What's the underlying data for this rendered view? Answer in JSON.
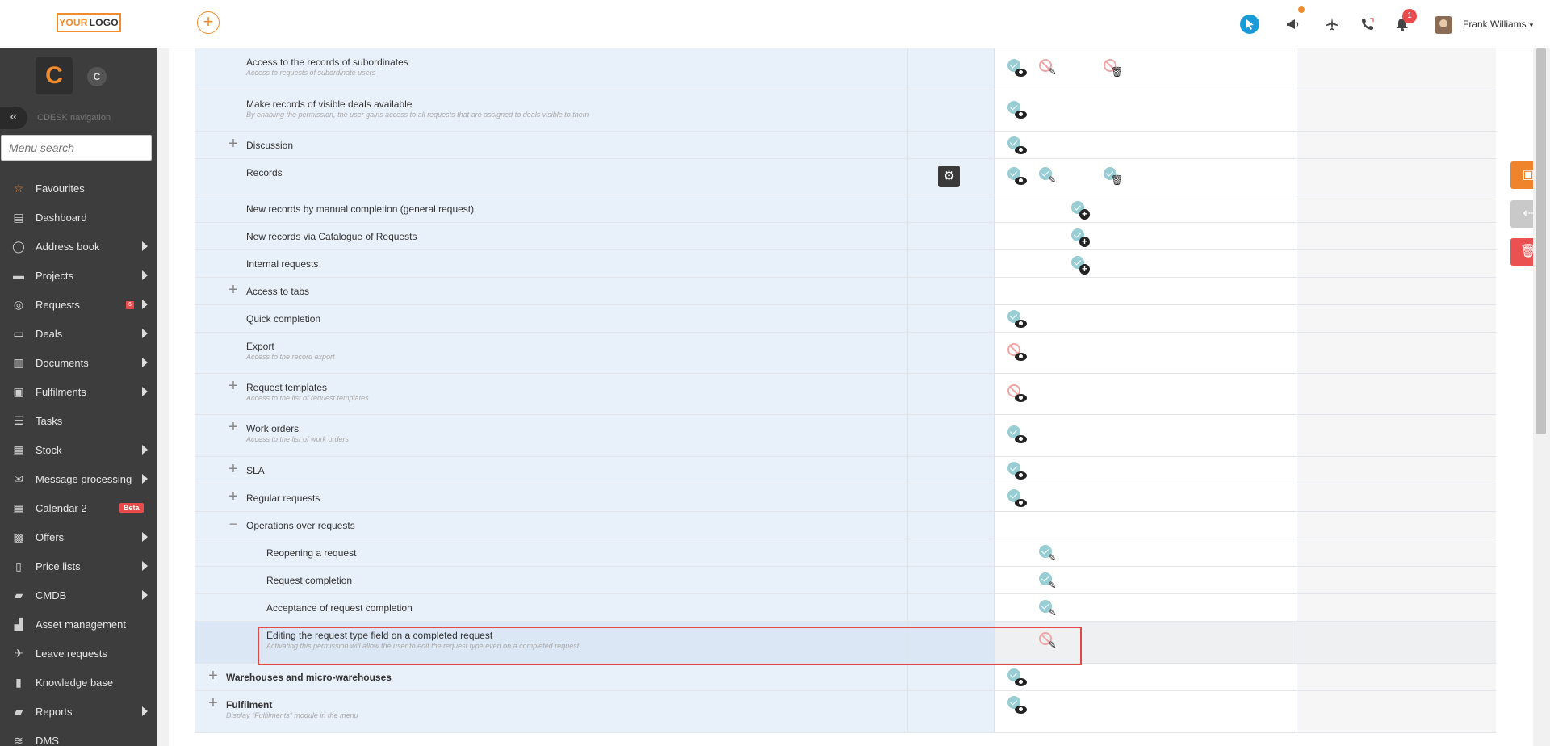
{
  "header": {
    "logo_part1": "YOUR",
    "logo_part2": "LOGO",
    "add_symbol": "+",
    "notifications_count": "1",
    "user_name": "Frank Williams",
    "caret": "▾"
  },
  "sidebar": {
    "logo_letter": "C",
    "secondary_letter": "C",
    "collapse_symbol": "«",
    "nav_label": "CDESK navigation",
    "search_placeholder": "Menu search",
    "items": [
      {
        "label": "Favourites",
        "icon": "star-icon",
        "glyph": "☆",
        "arrow": false
      },
      {
        "label": "Dashboard",
        "icon": "dashboard-icon",
        "glyph": "▤",
        "arrow": false
      },
      {
        "label": "Address book",
        "icon": "person-icon",
        "glyph": "◯",
        "arrow": true
      },
      {
        "label": "Projects",
        "icon": "projects-icon",
        "glyph": "▬",
        "arrow": true
      },
      {
        "label": "Requests",
        "icon": "requests-icon",
        "glyph": "◎",
        "arrow": true,
        "badge": "6"
      },
      {
        "label": "Deals",
        "icon": "deals-icon",
        "glyph": "▭",
        "arrow": true
      },
      {
        "label": "Documents",
        "icon": "documents-icon",
        "glyph": "▥",
        "arrow": true
      },
      {
        "label": "Fulfilments",
        "icon": "box-icon",
        "glyph": "▣",
        "arrow": true
      },
      {
        "label": "Tasks",
        "icon": "tasks-icon",
        "glyph": "☰",
        "arrow": false
      },
      {
        "label": "Stock",
        "icon": "stock-icon",
        "glyph": "▦",
        "arrow": true
      },
      {
        "label": "Message processing",
        "icon": "envelope-icon",
        "glyph": "✉",
        "arrow": true
      },
      {
        "label": "Calendar 2",
        "icon": "calendar-icon",
        "glyph": "▦",
        "arrow": false,
        "beta": "Beta"
      },
      {
        "label": "Offers",
        "icon": "gift-icon",
        "glyph": "▩",
        "arrow": true
      },
      {
        "label": "Price lists",
        "icon": "pricelist-icon",
        "glyph": "▯",
        "arrow": true
      },
      {
        "label": "CMDB",
        "icon": "folder-icon",
        "glyph": "▰",
        "arrow": true
      },
      {
        "label": "Asset management",
        "icon": "asset-icon",
        "glyph": "▟",
        "arrow": false
      },
      {
        "label": "Leave requests",
        "icon": "plane-icon",
        "glyph": "✈",
        "arrow": false
      },
      {
        "label": "Knowledge base",
        "icon": "book-icon",
        "glyph": "▮",
        "arrow": false
      },
      {
        "label": "Reports",
        "icon": "reports-icon",
        "glyph": "▰",
        "arrow": true
      },
      {
        "label": "DMS",
        "icon": "database-icon",
        "glyph": "≋",
        "arrow": false
      }
    ]
  },
  "permissions": {
    "rows": [
      {
        "label": "Access to the records of subordinates",
        "sub": "Access to requests of subordinate users"
      },
      {
        "label": "Make records of visible deals available",
        "sub": "By enabling the permission, the user gains access to all requests that are assigned to deals visible to them"
      },
      {
        "label": "Discussion"
      },
      {
        "label": "Records"
      },
      {
        "label": "New records by manual completion (general request)"
      },
      {
        "label": "New records via Catalogue of Requests"
      },
      {
        "label": "Internal requests"
      },
      {
        "label": "Access to tabs"
      },
      {
        "label": "Quick completion"
      },
      {
        "label": "Export",
        "sub": "Access to the record export"
      },
      {
        "label": "Request templates",
        "sub": "Access to the list of request templates"
      },
      {
        "label": "Work orders",
        "sub": "Access to the list of work orders"
      },
      {
        "label": "SLA"
      },
      {
        "label": "Regular requests"
      },
      {
        "label": "Operations over requests"
      },
      {
        "label": "Reopening a request"
      },
      {
        "label": "Request completion"
      },
      {
        "label": "Acceptance of request completion"
      },
      {
        "label": "Editing the request type field on a completed request",
        "sub": "Activating this permission will allow the user to edit the request type even on a completed request"
      },
      {
        "label": "Warehouses and micro-warehouses"
      },
      {
        "label": "Fulfilment",
        "sub": "Display \"Fulfilments\" module in the menu"
      }
    ],
    "plus_symbol": "+",
    "minus_symbol": "−",
    "gear_symbol": "⚙",
    "pencil_symbol": "✎",
    "trash_symbol": "🗑",
    "add_symbol": "+"
  },
  "actions": {
    "save_glyph": "▣",
    "back_glyph": "⇠",
    "delete_glyph": "🗑"
  }
}
